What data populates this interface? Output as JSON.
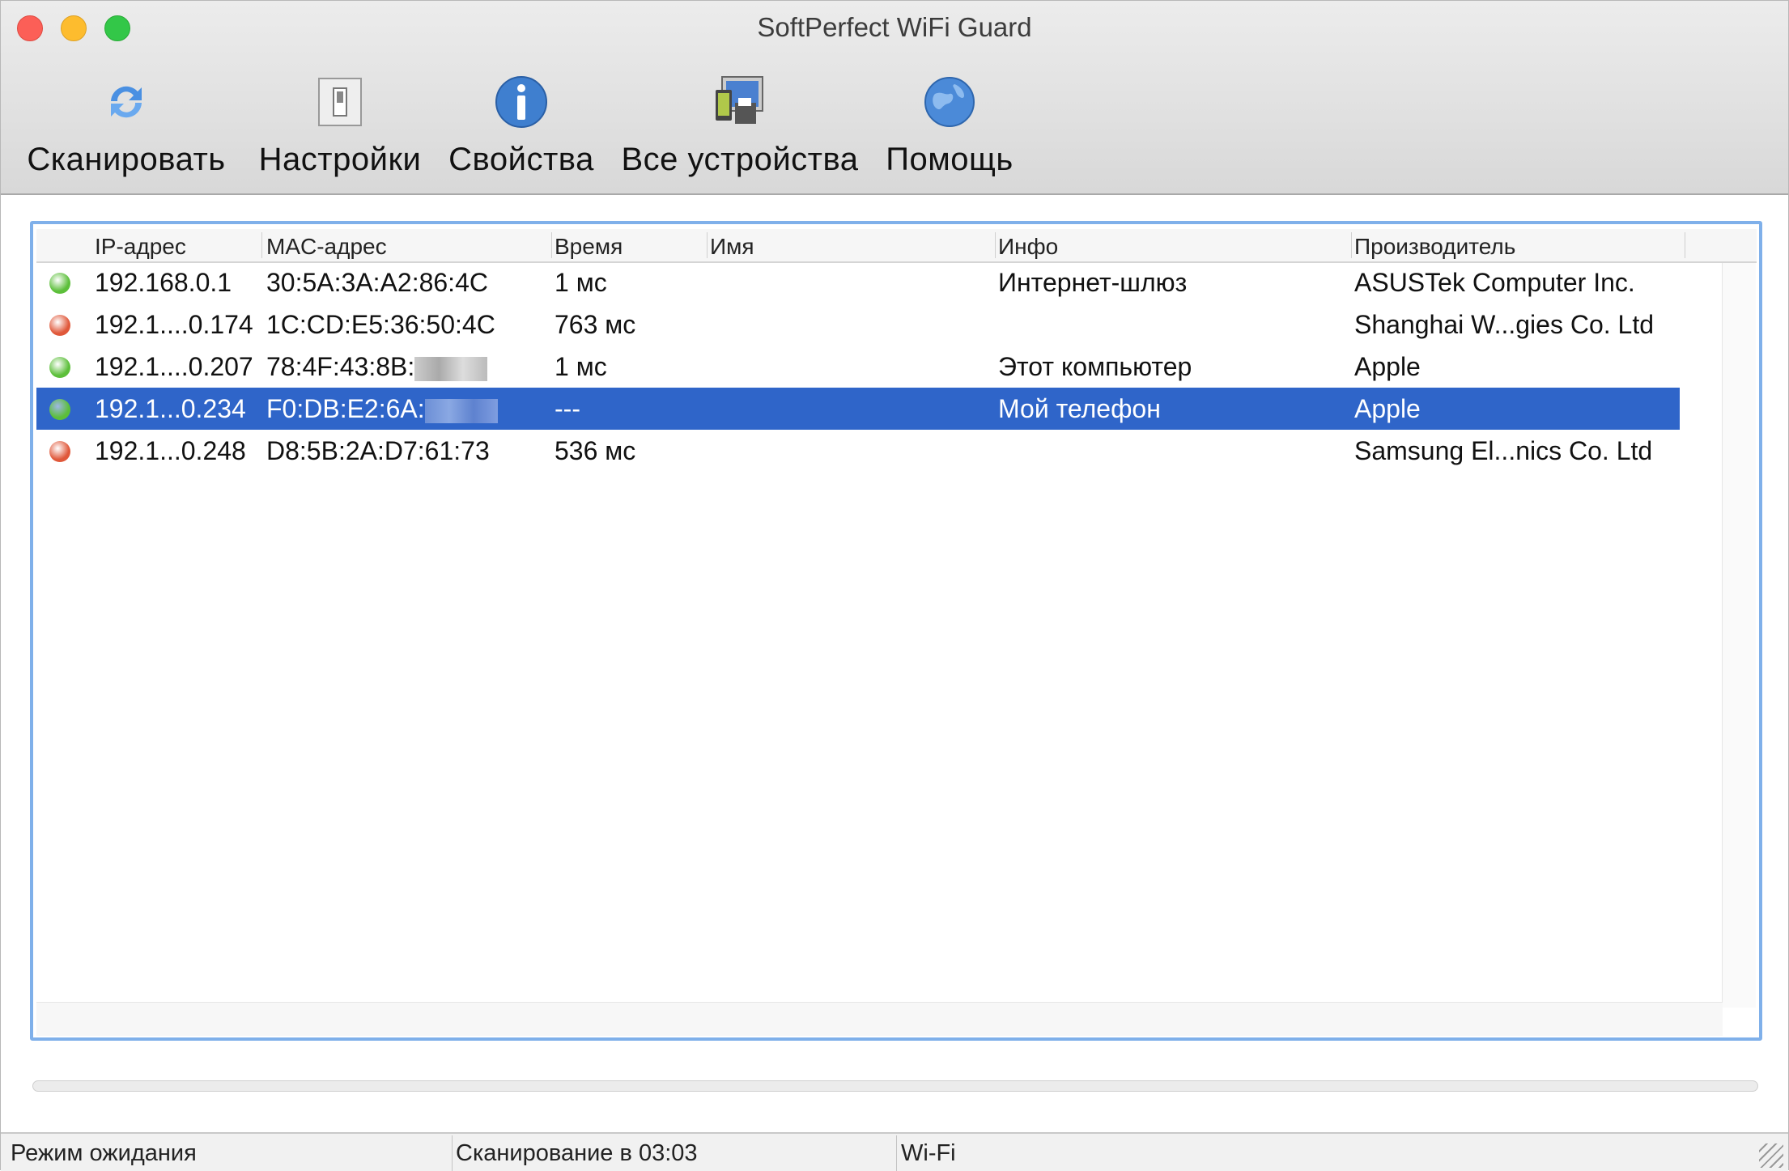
{
  "window": {
    "title": "SoftPerfect WiFi Guard"
  },
  "toolbar": [
    {
      "label": "Сканировать",
      "icon": "refresh-icon"
    },
    {
      "label": "Настройки",
      "icon": "switch-icon"
    },
    {
      "label": "Свойства",
      "icon": "info-icon"
    },
    {
      "label": "Все устройства",
      "icon": "devices-icon"
    },
    {
      "label": "Помощь",
      "icon": "globe-icon"
    }
  ],
  "table": {
    "columns": [
      "IP-адрес",
      "MAC-адрес",
      "Время",
      "Имя",
      "Инфо",
      "Производитель"
    ],
    "rows": [
      {
        "status": "online",
        "ip": "192.168.0.1",
        "mac": "30:5A:3A:A2:86:4C",
        "time": "1 мс",
        "name": "",
        "info": "Интернет-шлюз",
        "vendor": "ASUSTek Computer Inc."
      },
      {
        "status": "offline",
        "ip": "192.1....0.174",
        "mac": "1C:CD:E5:36:50:4C",
        "time": "763 мс",
        "name": "",
        "info": "",
        "vendor": "Shanghai W...gies Co. Ltd"
      },
      {
        "status": "online",
        "ip": "192.1....0.207",
        "mac": "78:4F:43:8B:",
        "time": "1 мс",
        "name": "",
        "info": "Этот компьютер",
        "vendor": "Apple"
      },
      {
        "status": "online",
        "ip": "192.1...0.234",
        "mac": "F0:DB:E2:6A:",
        "time": "---",
        "name": "",
        "info": "Мой телефон",
        "vendor": "Apple",
        "selected": true
      },
      {
        "status": "offline",
        "ip": "192.1...0.248",
        "mac": "D8:5B:2A:D7:61:73",
        "time": "536 мс",
        "name": "",
        "info": "",
        "vendor": "Samsung El...nics Co. Ltd"
      }
    ]
  },
  "statusbar": {
    "state": "Режим ожидания",
    "scan": "Сканирование в 03:03",
    "interface": "Wi-Fi"
  },
  "colors": {
    "online": "#5cbf3a",
    "offline": "#e0583a",
    "selection": "#2f65c9"
  }
}
